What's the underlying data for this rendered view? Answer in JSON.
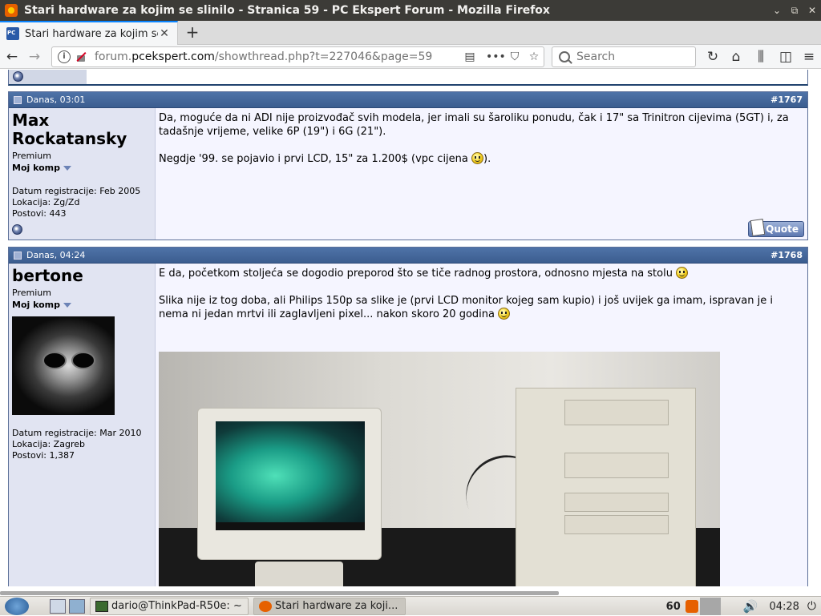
{
  "window": {
    "title": "Stari hardware za kojim se slinilo - Stranica 59 - PC Ekspert Forum - Mozilla Firefox",
    "minimize": "⌄",
    "maximize": "⧉",
    "close": "✕"
  },
  "tab": {
    "title": "Stari hardware za kojim se slinilo",
    "close": "✕",
    "new_tab": "+"
  },
  "nav": {
    "back": "←",
    "forward": "→",
    "url_prefix": "forum.",
    "url_domain": "pcekspert.com",
    "url_path": "/showthread.php?t=227046&page=59",
    "reader": "▤",
    "more": "•••",
    "pocket": "⛉",
    "bookmark": "☆",
    "search_placeholder": "Search",
    "reload": "↻",
    "home": "⌂",
    "library": "⫼",
    "sidebar": "◫",
    "menu": "≡"
  },
  "posts": [
    {
      "date": "Danas, 03:01",
      "number": "#1767",
      "user": {
        "name": "Max Rockatansky",
        "rank": "Premium",
        "moj_komp": "Moj komp",
        "registered": "Datum registracije: Feb 2005",
        "location": "Lokacija: Zg/Zd",
        "posts": "Postovi: 443"
      },
      "paragraphs": [
        "Da, moguće da ni ADI nije proizvođač svih modela, jer imali su šaroliku ponudu, čak i 17\" sa Trinitron cijevima (5GT) i, za tadašnje vrijeme, velike 6P (19\") i 6G (21\").",
        "Negdje '99. se pojavio i prvi LCD, 15\" za 1.200$ (vpc cijena "
      ],
      "paragraph_tail": ").",
      "quote": "Quote"
    },
    {
      "date": "Danas, 04:24",
      "number": "#1768",
      "user": {
        "name": "bertone",
        "rank": "Premium",
        "moj_komp": "Moj komp",
        "registered": "Datum registracije: Mar 2010",
        "location": "Lokacija: Zagreb",
        "posts": "Postovi: 1,387"
      },
      "paragraphs": [
        "E da, početkom stoljeća se dogodio preporod što se tiče radnog prostora, odnosno mjesta na stolu ",
        "Slika nije iz tog doba, ali Philips 150p sa slike je (prvi LCD monitor kojeg sam kupio) i još uvijek ga imam, ispravan je i nema ni jedan mrtvi ili zaglavljeni pixel... nakon skoro 20 godina "
      ]
    }
  ],
  "taskbar": {
    "terminal_task": "dario@ThinkPad-R50e: ~",
    "firefox_task": "Stari hardware za koji...",
    "indicator": "60",
    "volume": "🔊",
    "clock": "04:28",
    "power": "⏻"
  }
}
